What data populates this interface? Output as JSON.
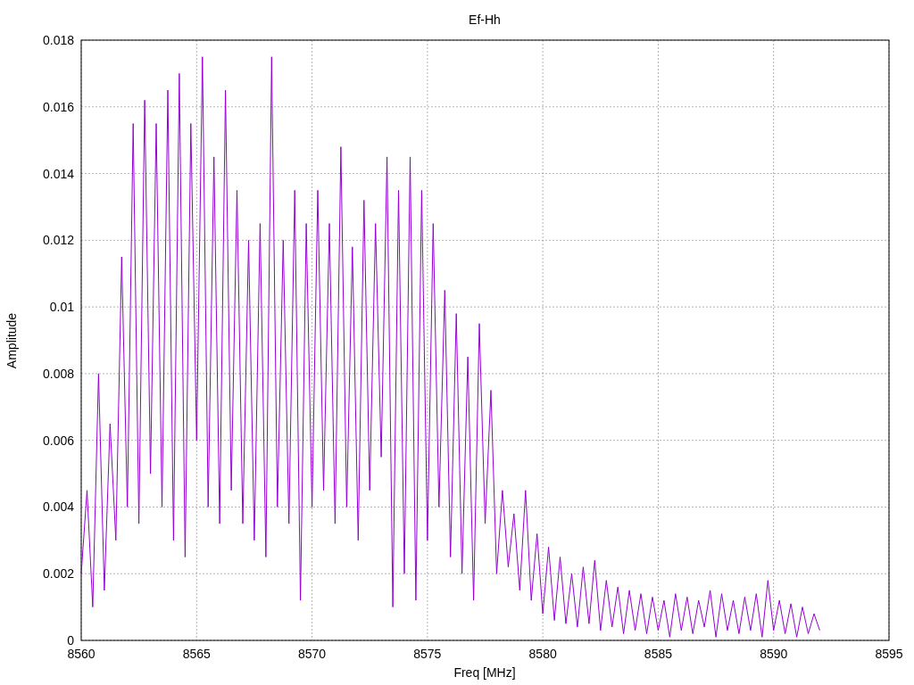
{
  "chart_data": {
    "type": "line",
    "title": "Ef-Hh",
    "xlabel": "Freq [MHz]",
    "ylabel": "Amplitude",
    "xlim": [
      8560,
      8595
    ],
    "ylim": [
      0,
      0.018
    ],
    "xticks": [
      8560,
      8565,
      8570,
      8575,
      8580,
      8585,
      8590,
      8595
    ],
    "yticks": [
      {
        "value": 0,
        "label": "0"
      },
      {
        "value": 0.002,
        "label": "0.002"
      },
      {
        "value": 0.004,
        "label": "0.004"
      },
      {
        "value": 0.006,
        "label": "0.006"
      },
      {
        "value": 0.008,
        "label": "0.008"
      },
      {
        "value": 0.01,
        "label": "0.01"
      },
      {
        "value": 0.012,
        "label": "0.012"
      },
      {
        "value": 0.014,
        "label": "0.014"
      },
      {
        "value": 0.016,
        "label": "0.016"
      },
      {
        "value": 0.018,
        "label": "0.018"
      }
    ],
    "x": [
      8560,
      8560.25,
      8560.5,
      8560.75,
      8561,
      8561.25,
      8561.5,
      8561.75,
      8562,
      8562.25,
      8562.5,
      8562.75,
      8563,
      8563.25,
      8563.5,
      8563.75,
      8564,
      8564.25,
      8564.5,
      8564.75,
      8565,
      8565.25,
      8565.5,
      8565.75,
      8566,
      8566.25,
      8566.5,
      8566.75,
      8567,
      8567.25,
      8567.5,
      8567.75,
      8568,
      8568.25,
      8568.5,
      8568.75,
      8569,
      8569.25,
      8569.5,
      8569.75,
      8570,
      8570.25,
      8570.5,
      8570.75,
      8571,
      8571.25,
      8571.5,
      8571.75,
      8572,
      8572.25,
      8572.5,
      8572.75,
      8573,
      8573.25,
      8573.5,
      8573.75,
      8574,
      8574.25,
      8574.5,
      8574.75,
      8575,
      8575.25,
      8575.5,
      8575.75,
      8576,
      8576.25,
      8576.5,
      8576.75,
      8577,
      8577.25,
      8577.5,
      8577.75,
      8578,
      8578.25,
      8578.5,
      8578.75,
      8579,
      8579.25,
      8579.5,
      8579.75,
      8580,
      8580.25,
      8580.5,
      8580.75,
      8581,
      8581.25,
      8581.5,
      8581.75,
      8582,
      8582.25,
      8582.5,
      8582.75,
      8583,
      8583.25,
      8583.5,
      8583.75,
      8584,
      8584.25,
      8584.5,
      8584.75,
      8585,
      8585.25,
      8585.5,
      8585.75,
      8586,
      8586.25,
      8586.5,
      8586.75,
      8587,
      8587.25,
      8587.5,
      8587.75,
      8588,
      8588.25,
      8588.5,
      8588.75,
      8589,
      8589.25,
      8589.5,
      8589.75,
      8590,
      8590.25,
      8590.5,
      8590.75,
      8591,
      8591.25,
      8591.5,
      8591.75,
      8592
    ],
    "grid": true,
    "series": [
      {
        "color": "#9400d3",
        "values": [
          0.002,
          0.0045,
          0.001,
          0.008,
          0.0015,
          0.0065,
          0.003,
          0.0115,
          0.004,
          0.0155,
          0.0035,
          0.0162,
          0.005,
          0.0155,
          0.004,
          0.0165,
          0.003,
          0.017,
          0.0025,
          0.0155,
          0.006,
          0.0175,
          0.004,
          0.0145,
          0.0035,
          0.0165,
          0.0045,
          0.0135,
          0.0035,
          0.012,
          0.003,
          0.0125,
          0.0025,
          0.0175,
          0.004,
          0.012,
          0.0035,
          0.0135,
          0.0012,
          0.0125,
          0.004,
          0.0135,
          0.0045,
          0.0125,
          0.0035,
          0.0148,
          0.004,
          0.0118,
          0.003,
          0.0132,
          0.0045,
          0.0125,
          0.0055,
          0.0145,
          0.001,
          0.0135,
          0.002,
          0.0145,
          0.0012,
          0.0135,
          0.003,
          0.0125,
          0.004,
          0.0105,
          0.0025,
          0.0098,
          0.002,
          0.0085,
          0.0012,
          0.0095,
          0.0035,
          0.0075,
          0.002,
          0.0045,
          0.0022,
          0.0038,
          0.0015,
          0.0045,
          0.0012,
          0.0032,
          0.0008,
          0.0028,
          0.0006,
          0.0025,
          0.0005,
          0.002,
          0.0004,
          0.0022,
          0.0005,
          0.0024,
          0.0003,
          0.0018,
          0.0004,
          0.0016,
          0.0002,
          0.0015,
          0.0003,
          0.0014,
          0.0002,
          0.0013,
          0.0003,
          0.0012,
          0.0001,
          0.0014,
          0.0003,
          0.0013,
          0.0002,
          0.0012,
          0.0004,
          0.0015,
          0.0001,
          0.0014,
          0.0003,
          0.0012,
          0.0002,
          0.0013,
          0.0003,
          0.0014,
          0.0001,
          0.0018,
          0.0003,
          0.0012,
          0.0002,
          0.0011,
          0.0001,
          0.001,
          0.0002,
          0.0008,
          0.0003
        ]
      }
    ]
  }
}
